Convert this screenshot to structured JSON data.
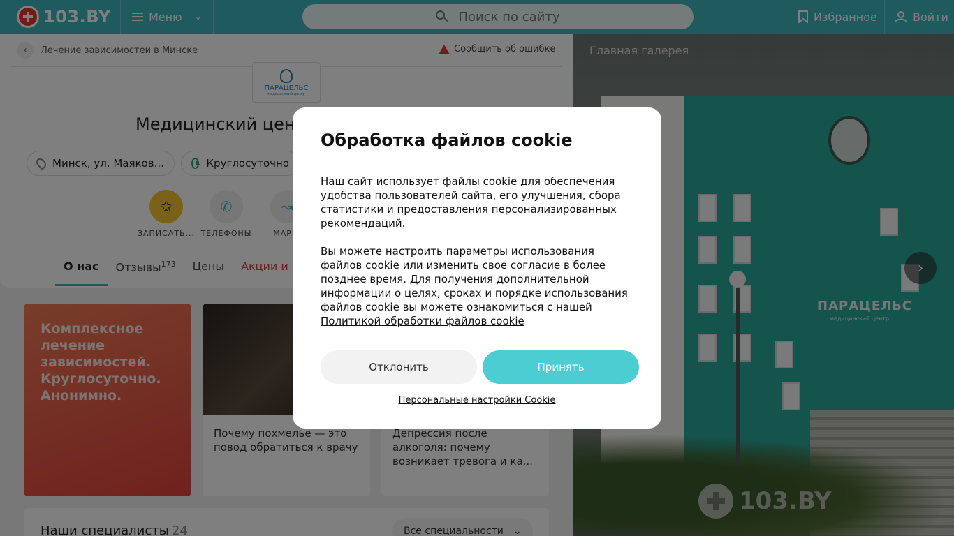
{
  "header": {
    "logo_text": "103.BY",
    "menu_label": "Меню",
    "search_placeholder": "Поиск по сайту",
    "favorites_label": "Избранное",
    "login_label": "Войти",
    "brand_color": "#3fb5bd"
  },
  "page": {
    "breadcrumb": "Лечение зависимостей в Минске",
    "report_label": "Сообщить об ошибке",
    "clinic_logo_name": "ПАРАЦЕЛЬС",
    "clinic_logo_sub": "медицинский центр",
    "title": "Медицинский цен",
    "address": "Минск, ул. Маяков...",
    "hours": "Круглосуточно",
    "actions": [
      "ЗАПИСАТЬ...",
      "ТЕЛЕФОНЫ",
      "МАРШ"
    ],
    "tabs": [
      {
        "label": "О нас",
        "active": true
      },
      {
        "label": "Отзывы",
        "count": "173"
      },
      {
        "label": "Цены"
      },
      {
        "label": "Акции и но"
      }
    ],
    "promo_text": "Комплексное лечение зависимостей. Круглосуточно. Анонимно.",
    "articles": [
      {
        "title": "Почему похмелье — это повод обратиться к врачу"
      },
      {
        "title": "Депрессия после алкоголя: почему возникает тревога и ка..."
      }
    ],
    "specialists_label": "Наши специалисты",
    "specialists_count": "24",
    "specialties_dropdown": "Все специальности"
  },
  "gallery": {
    "title": "Главная галерея",
    "sign_text": "ПАРАЦЕЛЬС",
    "sign_sub": "медицинский центр",
    "watermark": "103.BY"
  },
  "cookie_modal": {
    "title": "Обработка файлов cookie",
    "paragraph1": "Наш сайт использует файлы cookie для обеспечения удобства пользователей сайта, его улучшения, сбора статистики и предоставления персонализированных рекомендаций.",
    "paragraph2": "Вы можете настроить параметры использования файлов cookie или изменить свое согласие в более позднее время. Для получения дополнительной информации о целях, сроках и порядке использования файлов cookie вы можете ознакомиться с нашей",
    "policy_link": "Политикой обработки файлов cookie",
    "decline_label": "Отклонить",
    "accept_label": "Принять",
    "settings_link": "Персональные настройки Cookie",
    "accept_color": "#4ccdd2"
  }
}
